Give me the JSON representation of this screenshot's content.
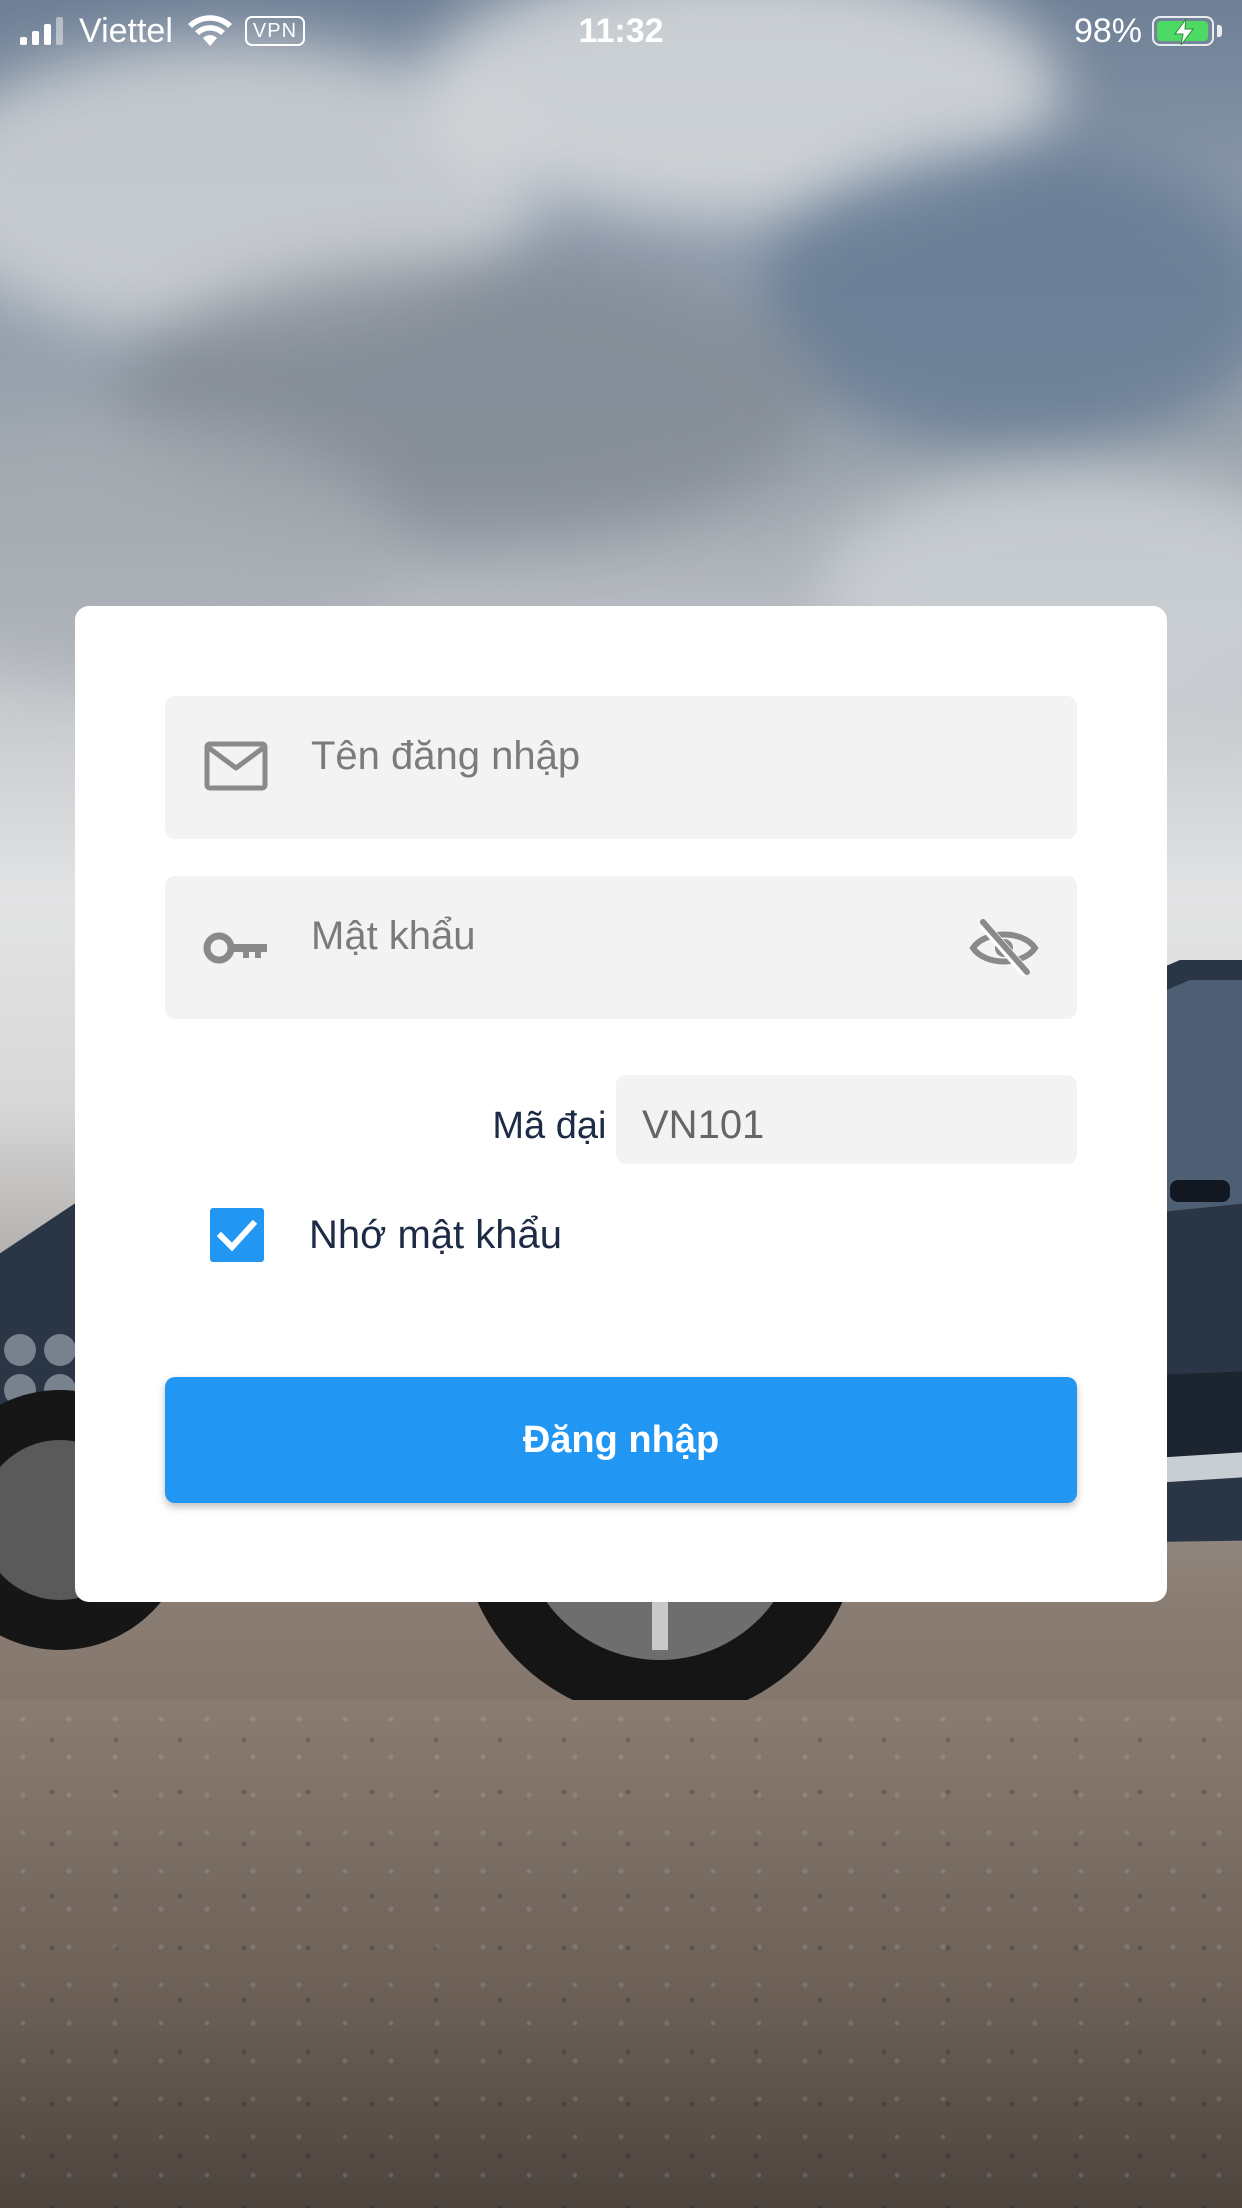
{
  "status_bar": {
    "carrier": "Viettel",
    "vpn_label": "VPN",
    "time": "11:32",
    "battery_percent": "98%",
    "battery_level": 0.98,
    "charging": true
  },
  "login_form": {
    "username": {
      "placeholder": "Tên đăng nhập",
      "value": "",
      "icon": "mail-icon"
    },
    "password": {
      "placeholder": "Mật khẩu",
      "value": "",
      "icon": "key-icon",
      "toggle_icon": "eye-off-icon"
    },
    "agent_code": {
      "label": "Mã đại lý:",
      "value": "VN101"
    },
    "remember_password": {
      "label": "Nhớ mật khẩu",
      "checked": true
    },
    "submit_label": "Đăng nhập"
  },
  "colors": {
    "accent": "#2196f3",
    "field_background": "#f3f3f3",
    "card_background": "#ffffff",
    "label_text": "#1d2b45"
  }
}
